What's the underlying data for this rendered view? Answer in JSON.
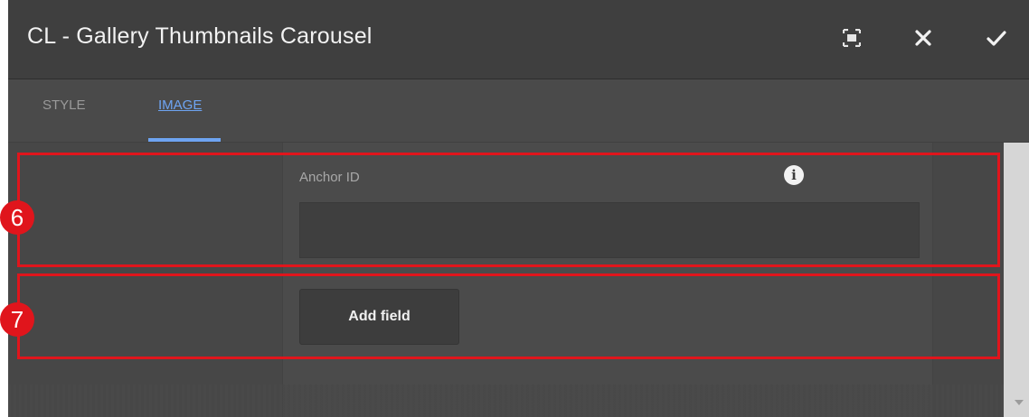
{
  "dialog": {
    "title": "CL - Gallery Thumbnails Carousel",
    "actions": [
      {
        "name": "fullscreen",
        "icon": "fullscreen-icon"
      },
      {
        "name": "close",
        "icon": "close-icon"
      },
      {
        "name": "confirm",
        "icon": "checkmark-icon"
      }
    ]
  },
  "tabs": [
    {
      "label": "STYLE",
      "active": false
    },
    {
      "label": "IMAGE",
      "active": true
    }
  ],
  "form": {
    "anchor_label": "Anchor ID",
    "anchor_value": "",
    "info_icon": "info-icon",
    "add_field_label": "Add field"
  },
  "annotations": [
    {
      "number": "6"
    },
    {
      "number": "7"
    }
  ],
  "colors": {
    "accent": "#6ea4f2",
    "annotation": "#e0151c",
    "titlebar": "#3f3f3f",
    "panel": "#4a4a4a"
  }
}
